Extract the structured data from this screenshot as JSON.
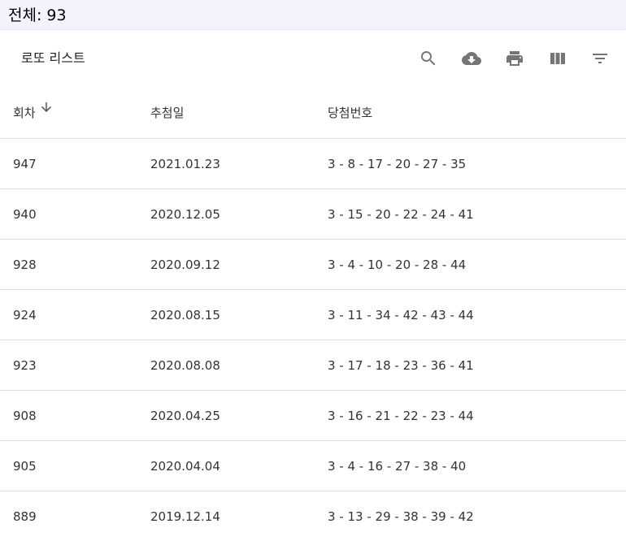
{
  "summary": {
    "label": "전체: 93"
  },
  "toolbar": {
    "title": "로또 리스트",
    "icons": [
      "search-icon",
      "download-icon",
      "print-icon",
      "view-columns-icon",
      "filter-icon"
    ]
  },
  "table": {
    "columns": [
      "회차",
      "추첨일",
      "당첨번호"
    ],
    "sort": {
      "column": "회차",
      "direction": "desc"
    },
    "rows": [
      [
        "947",
        "2021.01.23",
        "3 - 8 - 17 - 20 - 27 - 35"
      ],
      [
        "940",
        "2020.12.05",
        "3 - 15 - 20 - 22 - 24 - 41"
      ],
      [
        "928",
        "2020.09.12",
        "3 - 4 - 10 - 20 - 28 - 44"
      ],
      [
        "924",
        "2020.08.15",
        "3 - 11 - 34 - 42 - 43 - 44"
      ],
      [
        "923",
        "2020.08.08",
        "3 - 17 - 18 - 23 - 36 - 41"
      ],
      [
        "908",
        "2020.04.25",
        "3 - 16 - 21 - 22 - 23 - 44"
      ],
      [
        "905",
        "2020.04.04",
        "3 - 4 - 16 - 27 - 38 - 40"
      ],
      [
        "889",
        "2019.12.14",
        "3 - 13 - 29 - 38 - 39 - 42"
      ]
    ]
  }
}
